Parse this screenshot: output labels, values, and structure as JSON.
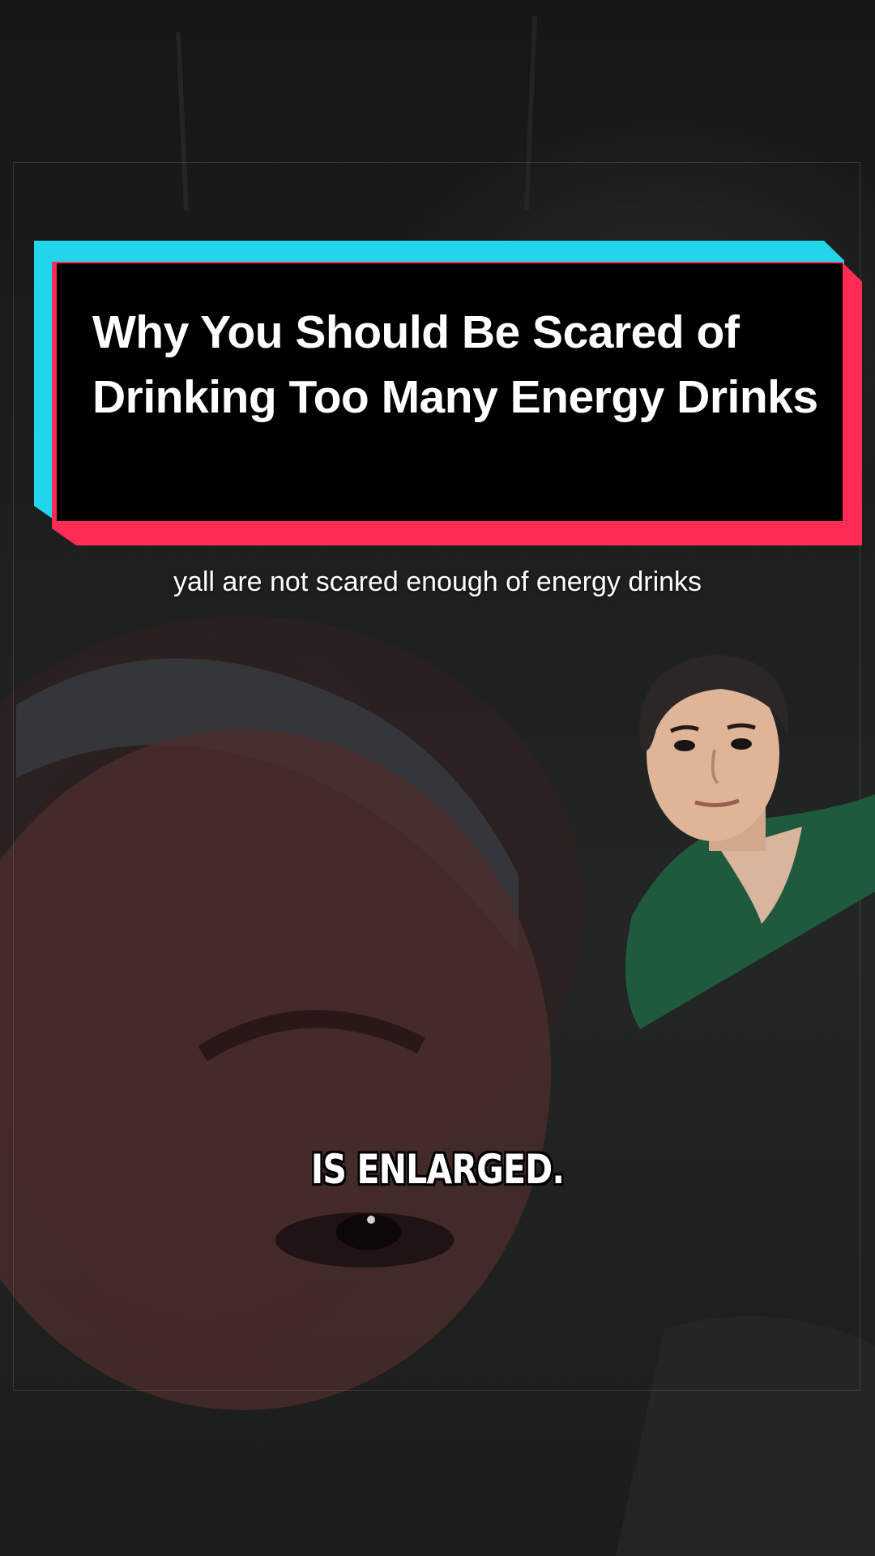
{
  "video": {
    "title_overlay": "Why You Should Be Scared of Drinking Too Many Energy Drinks",
    "caption_top": "yall are not scared enough of energy drinks",
    "subtitle": "IS ENLARGED."
  },
  "colors": {
    "accent_cyan": "#20d5ec",
    "accent_red": "#fe2c55",
    "title_bg": "#000000",
    "text": "#ffffff"
  }
}
